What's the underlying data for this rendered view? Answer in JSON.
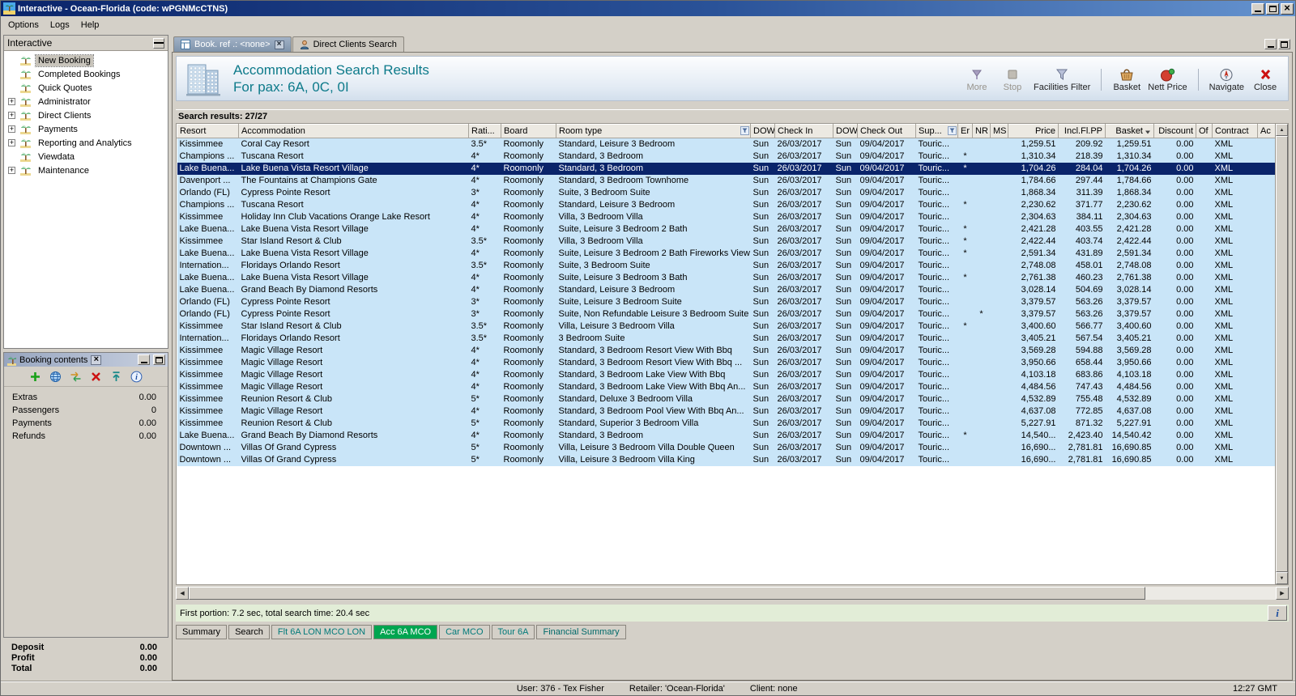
{
  "window": {
    "title": "Interactive - Ocean-Florida (code: wPGNMcCTNS)",
    "menu": [
      "Options",
      "Logs",
      "Help"
    ]
  },
  "sidebar": {
    "title": "Interactive",
    "items": [
      {
        "label": "New Booking",
        "expandable": false,
        "selected": true
      },
      {
        "label": "Completed Bookings",
        "expandable": false
      },
      {
        "label": "Quick Quotes",
        "expandable": false
      },
      {
        "label": "Administrator",
        "expandable": true
      },
      {
        "label": "Direct Clients",
        "expandable": true
      },
      {
        "label": "Payments",
        "expandable": true
      },
      {
        "label": "Reporting and Analytics",
        "expandable": true
      },
      {
        "label": "Viewdata",
        "expandable": false
      },
      {
        "label": "Maintenance",
        "expandable": true
      }
    ]
  },
  "booking_contents": {
    "title": "Booking contents",
    "toolbar_icons": [
      "add-icon",
      "globe-icon",
      "transfer-icon",
      "delete-icon",
      "upload-icon",
      "info-icon"
    ],
    "rows": [
      {
        "label": "Extras",
        "value": "0.00"
      },
      {
        "label": "Passengers",
        "value": "0"
      },
      {
        "label": "Payments",
        "value": "0.00"
      },
      {
        "label": "Refunds",
        "value": "0.00"
      }
    ],
    "totals": [
      {
        "label": "Deposit",
        "value": "0.00"
      },
      {
        "label": "Profit",
        "value": "0.00"
      },
      {
        "label": "Total",
        "value": "0.00"
      }
    ]
  },
  "doc_tabs": [
    {
      "label": "Book. ref .: <none>",
      "icon": "booking-tab-icon",
      "active": true,
      "closable": true
    },
    {
      "label": "Direct Clients Search",
      "icon": "clients-tab-icon",
      "active": false
    }
  ],
  "header": {
    "title": "Accommodation Search Results",
    "subtitle": "For pax: 6A, 0C, 0I"
  },
  "toolbar": {
    "buttons": [
      {
        "label": "More",
        "icon": "more-icon",
        "disabled": true
      },
      {
        "label": "Stop",
        "icon": "stop-icon",
        "disabled": true
      },
      {
        "label": "Facilities Filter",
        "icon": "filter-icon",
        "group_end": true
      },
      {
        "label": "Basket",
        "icon": "basket-icon"
      },
      {
        "label": "Nett Price",
        "icon": "nett-price-icon",
        "group_end": true
      },
      {
        "label": "Navigate",
        "icon": "navigate-icon"
      },
      {
        "label": "Close",
        "icon": "close-tool-icon"
      }
    ]
  },
  "results": {
    "summary": "Search results: 27/27",
    "selected_index": 2,
    "columns": [
      {
        "label": "Resort"
      },
      {
        "label": "Accommodation"
      },
      {
        "label": "Rati..."
      },
      {
        "label": "Board"
      },
      {
        "label": "Room type",
        "filter": true
      },
      {
        "label": "DOW"
      },
      {
        "label": "Check In"
      },
      {
        "label": "DOW"
      },
      {
        "label": "Check Out"
      },
      {
        "label": "Sup...",
        "filter": true
      },
      {
        "label": "Er"
      },
      {
        "label": "NR"
      },
      {
        "label": "MS"
      },
      {
        "label": "Price"
      },
      {
        "label": "Incl.Fl.PP"
      },
      {
        "label": "Basket",
        "sort": true
      },
      {
        "label": "Discount"
      },
      {
        "label": "Of"
      },
      {
        "label": "Contract"
      },
      {
        "label": "Ac"
      }
    ],
    "row_defaults": {
      "board": "Roomonly",
      "dow_in": "Sun",
      "check_in": "26/03/2017",
      "dow_out": "Sun",
      "check_out": "09/04/2017",
      "sup": "Touric...",
      "er": "",
      "nr": "",
      "ms": "",
      "discount": "0.00",
      "of": "",
      "contract": "XML",
      "ac": ""
    },
    "rows": [
      {
        "resort": "Kissimmee",
        "accommodation": "Coral Cay Resort",
        "rating": "3.5*",
        "room_type": "Standard, Leisure 3 Bedroom",
        "price": "1,259.51",
        "incl_fl_pp": "209.92",
        "basket": "1,259.51"
      },
      {
        "resort": "Champions ...",
        "accommodation": "Tuscana Resort",
        "rating": "4*",
        "room_type": "Standard, 3 Bedroom",
        "er": "*",
        "price": "1,310.34",
        "incl_fl_pp": "218.39",
        "basket": "1,310.34"
      },
      {
        "resort": "Lake Buena...",
        "accommodation": "Lake Buena Vista Resort Village",
        "rating": "4*",
        "room_type": "Standard, 3 Bedroom",
        "er": "*",
        "price": "1,704.26",
        "incl_fl_pp": "284.04",
        "basket": "1,704.26"
      },
      {
        "resort": "Davenport ...",
        "accommodation": "The Fountains at Champions Gate",
        "rating": "4*",
        "room_type": "Standard, 3 Bedroom Townhome",
        "price": "1,784.66",
        "incl_fl_pp": "297.44",
        "basket": "1,784.66"
      },
      {
        "resort": "Orlando (FL)",
        "accommodation": "Cypress Pointe Resort",
        "rating": "3*",
        "room_type": "Suite, 3 Bedroom Suite",
        "price": "1,868.34",
        "incl_fl_pp": "311.39",
        "basket": "1,868.34"
      },
      {
        "resort": "Champions ...",
        "accommodation": "Tuscana Resort",
        "rating": "4*",
        "room_type": "Standard, Leisure 3 Bedroom",
        "er": "*",
        "price": "2,230.62",
        "incl_fl_pp": "371.77",
        "basket": "2,230.62"
      },
      {
        "resort": "Kissimmee",
        "accommodation": "Holiday Inn Club Vacations Orange Lake Resort",
        "rating": "4*",
        "room_type": "Villa, 3 Bedroom Villa",
        "price": "2,304.63",
        "incl_fl_pp": "384.11",
        "basket": "2,304.63"
      },
      {
        "resort": "Lake Buena...",
        "accommodation": "Lake Buena Vista Resort Village",
        "rating": "4*",
        "room_type": "Suite, Leisure 3 Bedroom 2 Bath",
        "er": "*",
        "price": "2,421.28",
        "incl_fl_pp": "403.55",
        "basket": "2,421.28"
      },
      {
        "resort": "Kissimmee",
        "accommodation": "Star Island Resort & Club",
        "rating": "3.5*",
        "room_type": "Villa, 3 Bedroom Villa",
        "er": "*",
        "price": "2,422.44",
        "incl_fl_pp": "403.74",
        "basket": "2,422.44"
      },
      {
        "resort": "Lake Buena...",
        "accommodation": "Lake Buena Vista Resort Village",
        "rating": "4*",
        "room_type": "Suite, Leisure 3 Bedroom 2 Bath Fireworks View",
        "er": "*",
        "price": "2,591.34",
        "incl_fl_pp": "431.89",
        "basket": "2,591.34"
      },
      {
        "resort": "Internation...",
        "accommodation": "Floridays Orlando Resort",
        "rating": "3.5*",
        "room_type": "Suite, 3 Bedroom Suite",
        "price": "2,748.08",
        "incl_fl_pp": "458.01",
        "basket": "2,748.08"
      },
      {
        "resort": "Lake Buena...",
        "accommodation": "Lake Buena Vista Resort Village",
        "rating": "4*",
        "room_type": "Suite, Leisure 3 Bedroom 3 Bath",
        "er": "*",
        "price": "2,761.38",
        "incl_fl_pp": "460.23",
        "basket": "2,761.38"
      },
      {
        "resort": "Lake Buena...",
        "accommodation": "Grand Beach By Diamond Resorts",
        "rating": "4*",
        "room_type": "Standard, Leisure 3 Bedroom",
        "price": "3,028.14",
        "incl_fl_pp": "504.69",
        "basket": "3,028.14"
      },
      {
        "resort": "Orlando (FL)",
        "accommodation": "Cypress Pointe Resort",
        "rating": "3*",
        "room_type": "Suite, Leisure 3 Bedroom Suite",
        "price": "3,379.57",
        "incl_fl_pp": "563.26",
        "basket": "3,379.57"
      },
      {
        "resort": "Orlando (FL)",
        "accommodation": "Cypress Pointe Resort",
        "rating": "3*",
        "room_type": "Suite, Non Refundable Leisure 3 Bedroom Suite",
        "nr": "*",
        "price": "3,379.57",
        "incl_fl_pp": "563.26",
        "basket": "3,379.57"
      },
      {
        "resort": "Kissimmee",
        "accommodation": "Star Island Resort & Club",
        "rating": "3.5*",
        "room_type": "Villa, Leisure 3 Bedroom Villa",
        "er": "*",
        "price": "3,400.60",
        "incl_fl_pp": "566.77",
        "basket": "3,400.60"
      },
      {
        "resort": "Internation...",
        "accommodation": "Floridays Orlando Resort",
        "rating": "3.5*",
        "room_type": "3 Bedroom Suite",
        "price": "3,405.21",
        "incl_fl_pp": "567.54",
        "basket": "3,405.21"
      },
      {
        "resort": "Kissimmee",
        "accommodation": "Magic Village Resort",
        "rating": "4*",
        "room_type": "Standard, 3 Bedroom Resort View With Bbq",
        "price": "3,569.28",
        "incl_fl_pp": "594.88",
        "basket": "3,569.28"
      },
      {
        "resort": "Kissimmee",
        "accommodation": "Magic Village Resort",
        "rating": "4*",
        "room_type": "Standard, 3 Bedroom Resort View With Bbq ...",
        "price": "3,950.66",
        "incl_fl_pp": "658.44",
        "basket": "3,950.66"
      },
      {
        "resort": "Kissimmee",
        "accommodation": "Magic Village Resort",
        "rating": "4*",
        "room_type": "Standard, 3 Bedroom Lake View With Bbq",
        "price": "4,103.18",
        "incl_fl_pp": "683.86",
        "basket": "4,103.18"
      },
      {
        "resort": "Kissimmee",
        "accommodation": "Magic Village Resort",
        "rating": "4*",
        "room_type": "Standard, 3 Bedroom Lake View With Bbq An...",
        "price": "4,484.56",
        "incl_fl_pp": "747.43",
        "basket": "4,484.56"
      },
      {
        "resort": "Kissimmee",
        "accommodation": "Reunion Resort & Club",
        "rating": "5*",
        "room_type": "Standard, Deluxe 3 Bedroom Villa",
        "price": "4,532.89",
        "incl_fl_pp": "755.48",
        "basket": "4,532.89"
      },
      {
        "resort": "Kissimmee",
        "accommodation": "Magic Village Resort",
        "rating": "4*",
        "room_type": "Standard, 3 Bedroom Pool View With Bbq An...",
        "price": "4,637.08",
        "incl_fl_pp": "772.85",
        "basket": "4,637.08"
      },
      {
        "resort": "Kissimmee",
        "accommodation": "Reunion Resort & Club",
        "rating": "5*",
        "room_type": "Standard, Superior 3 Bedroom Villa",
        "price": "5,227.91",
        "incl_fl_pp": "871.32",
        "basket": "5,227.91"
      },
      {
        "resort": "Lake Buena...",
        "accommodation": "Grand Beach By Diamond Resorts",
        "rating": "4*",
        "room_type": "Standard, 3 Bedroom",
        "er": "*",
        "price": "14,540...",
        "incl_fl_pp": "2,423.40",
        "basket": "14,540.42"
      },
      {
        "resort": "Downtown ...",
        "accommodation": "Villas Of Grand Cypress",
        "rating": "5*",
        "room_type": "Villa, Leisure 3 Bedroom Villa Double Queen",
        "price": "16,690...",
        "incl_fl_pp": "2,781.81",
        "basket": "16,690.85"
      },
      {
        "resort": "Downtown ...",
        "accommodation": "Villas Of Grand Cypress",
        "rating": "5*",
        "room_type": "Villa, Leisure 3 Bedroom Villa King",
        "price": "16,690...",
        "incl_fl_pp": "2,781.81",
        "basket": "16,690.85"
      }
    ]
  },
  "status_line": "First portion: 7.2 sec, total search time: 20.4 sec",
  "bottom_tabs": [
    {
      "label": "Summary"
    },
    {
      "label": "Search"
    },
    {
      "label": "Flt 6A LON MCO LON",
      "color": "#007a7a"
    },
    {
      "label": "Acc 6A MCO",
      "color": "#ffffff",
      "bg": "#00a550",
      "active": true
    },
    {
      "label": "Car MCO",
      "color": "#007a7a"
    },
    {
      "label": "Tour 6A",
      "color": "#007a7a"
    },
    {
      "label": "Financial Summary",
      "color": "#006a6a"
    }
  ],
  "statusbar": {
    "user": "User: 376 - Tex Fisher",
    "retailer": "Retailer: 'Ocean-Florida'",
    "client": "Client: none",
    "time": "12:27 GMT"
  }
}
